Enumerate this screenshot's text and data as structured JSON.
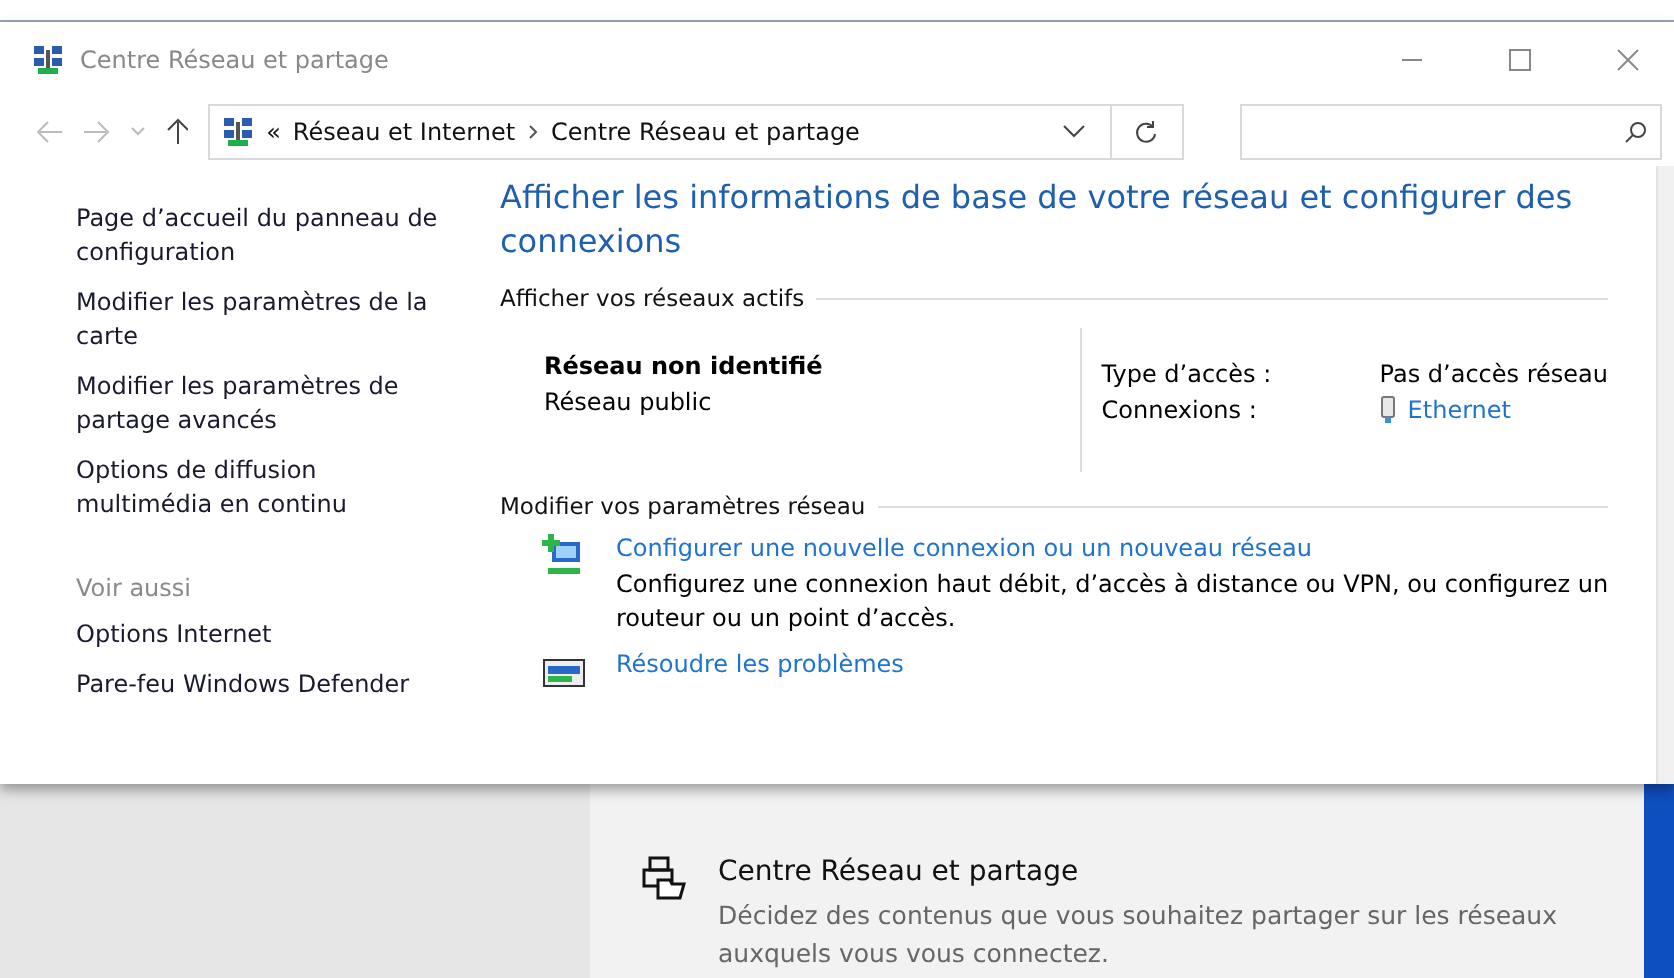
{
  "window": {
    "title": "Centre Réseau et partage"
  },
  "address_bar": {
    "overflow": "«",
    "path": [
      "Réseau et Internet",
      "Centre Réseau et partage"
    ]
  },
  "sidebar": {
    "links": [
      "Page d’accueil du panneau de configuration",
      "Modifier les paramètres de la carte",
      "Modifier les paramètres de partage avancés",
      "Options de diffusion multimédia en continu"
    ],
    "see_also": {
      "heading": "Voir aussi",
      "links": [
        "Options Internet",
        "Pare-feu Windows Defender"
      ]
    }
  },
  "heading": "Afficher les informations de base de votre réseau et configurer des connexions",
  "active_networks": {
    "heading": "Afficher vos réseaux actifs",
    "name": "Réseau non identifié",
    "category": "Réseau public",
    "details": [
      {
        "label": "Type d’accès :",
        "value": "Pas d’accès réseau",
        "kind": "text"
      },
      {
        "label": "Connexions :",
        "value": "Ethernet",
        "kind": "link"
      }
    ]
  },
  "change_settings": {
    "heading": "Modifier vos paramètres réseau",
    "tasks": [
      {
        "title": "Configurer une nouvelle connexion ou un nouveau réseau",
        "description": "Configurez une connexion haut débit, d’accès à distance ou VPN, ou configurez un routeur ou un point d’accès.",
        "kind": "new"
      },
      {
        "title": "Résoudre les problèmes",
        "kind": "troubleshoot"
      }
    ]
  },
  "settings_card": {
    "title": "Centre Réseau et partage",
    "description": "Décidez des contenus que vous souhaitez partager sur les réseaux auxquels vous vous connectez."
  }
}
